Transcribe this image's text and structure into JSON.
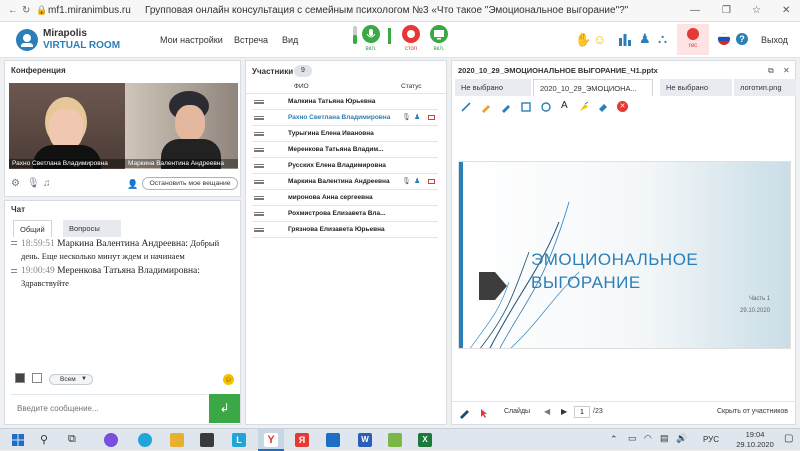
{
  "browser": {
    "url": "mf1.miranimbus.ru",
    "title": "Групповая онлайн консультация с семейным психологом №3 «Что такое \"Эмоциональное выгорание\"?\""
  },
  "app": {
    "brand_line1": "Mirapolis",
    "brand_line2": "VIRTUAL ROOM",
    "menu": [
      "Мои настройки",
      "Встреча",
      "Вид"
    ],
    "controls": {
      "mic": "вкл.",
      "stop": "стоп",
      "cam": "вкл.",
      "rec": "rec"
    },
    "exit": "Выход"
  },
  "conference": {
    "title": "Конференция",
    "videos": [
      {
        "name": "Рахно Светлана Владимировна"
      },
      {
        "name": "Маркина Валентина Андреевна"
      }
    ],
    "stop_broadcast": "Остановить мое вещание"
  },
  "chat": {
    "title": "Чат",
    "tabs": [
      "Общий",
      "Вопросы"
    ],
    "messages": [
      {
        "time": "18:59:51",
        "author": "Маркина Валентина Андреевна:",
        "text": "Добрый день. Еще несколько минут ждем и начинаем"
      },
      {
        "time": "19:00:49",
        "author": "Меренкова Татьяна Владимировна:",
        "text": "Здравствуйте"
      }
    ],
    "recipient": "Всем",
    "placeholder": "Введите сообщение..."
  },
  "participants": {
    "title": "Участники",
    "count": "9",
    "col_name": "ФИО",
    "col_status": "Статус",
    "rows": [
      {
        "name": "Малкина Татьяна Юрьевна"
      },
      {
        "name": "Рахно Светлана Владимировна"
      },
      {
        "name": "Турыгина Елена Ивановна"
      },
      {
        "name": "Меренкова Татьяна Владим..."
      },
      {
        "name": "Русских Елена Владимировна"
      },
      {
        "name": "Маркина Валентина Андреевна"
      },
      {
        "name": "миронова Анна сергеевна"
      },
      {
        "name": "Рохмистрова Елизавета Вла..."
      },
      {
        "name": "Грязнова Елизавета Юрьевна"
      }
    ]
  },
  "presentation": {
    "file": "2020_10_29_ЭМОЦИОНАЛЬНОЕ ВЫГОРАНИЕ_Ч1.pptx",
    "tabs": [
      "Не выбрано",
      "2020_10_29_ЭМОЦИОНА...",
      "Не выбрано",
      "логотип.png"
    ],
    "slide_title_1": "ЭМОЦИОНАЛЬНОЕ",
    "slide_title_2": "ВЫГОРАНИЕ",
    "slide_part": "Часть 1",
    "slide_date": "29.10.2020",
    "slides_label": "Слайды",
    "page": "1",
    "total": "/23",
    "hide": "Скрыть от участников",
    "colors": {
      "accent": "#2b7fb8"
    }
  },
  "taskbar": {
    "lang": "РУС",
    "time": "19:04",
    "date": "29.10.2020"
  }
}
